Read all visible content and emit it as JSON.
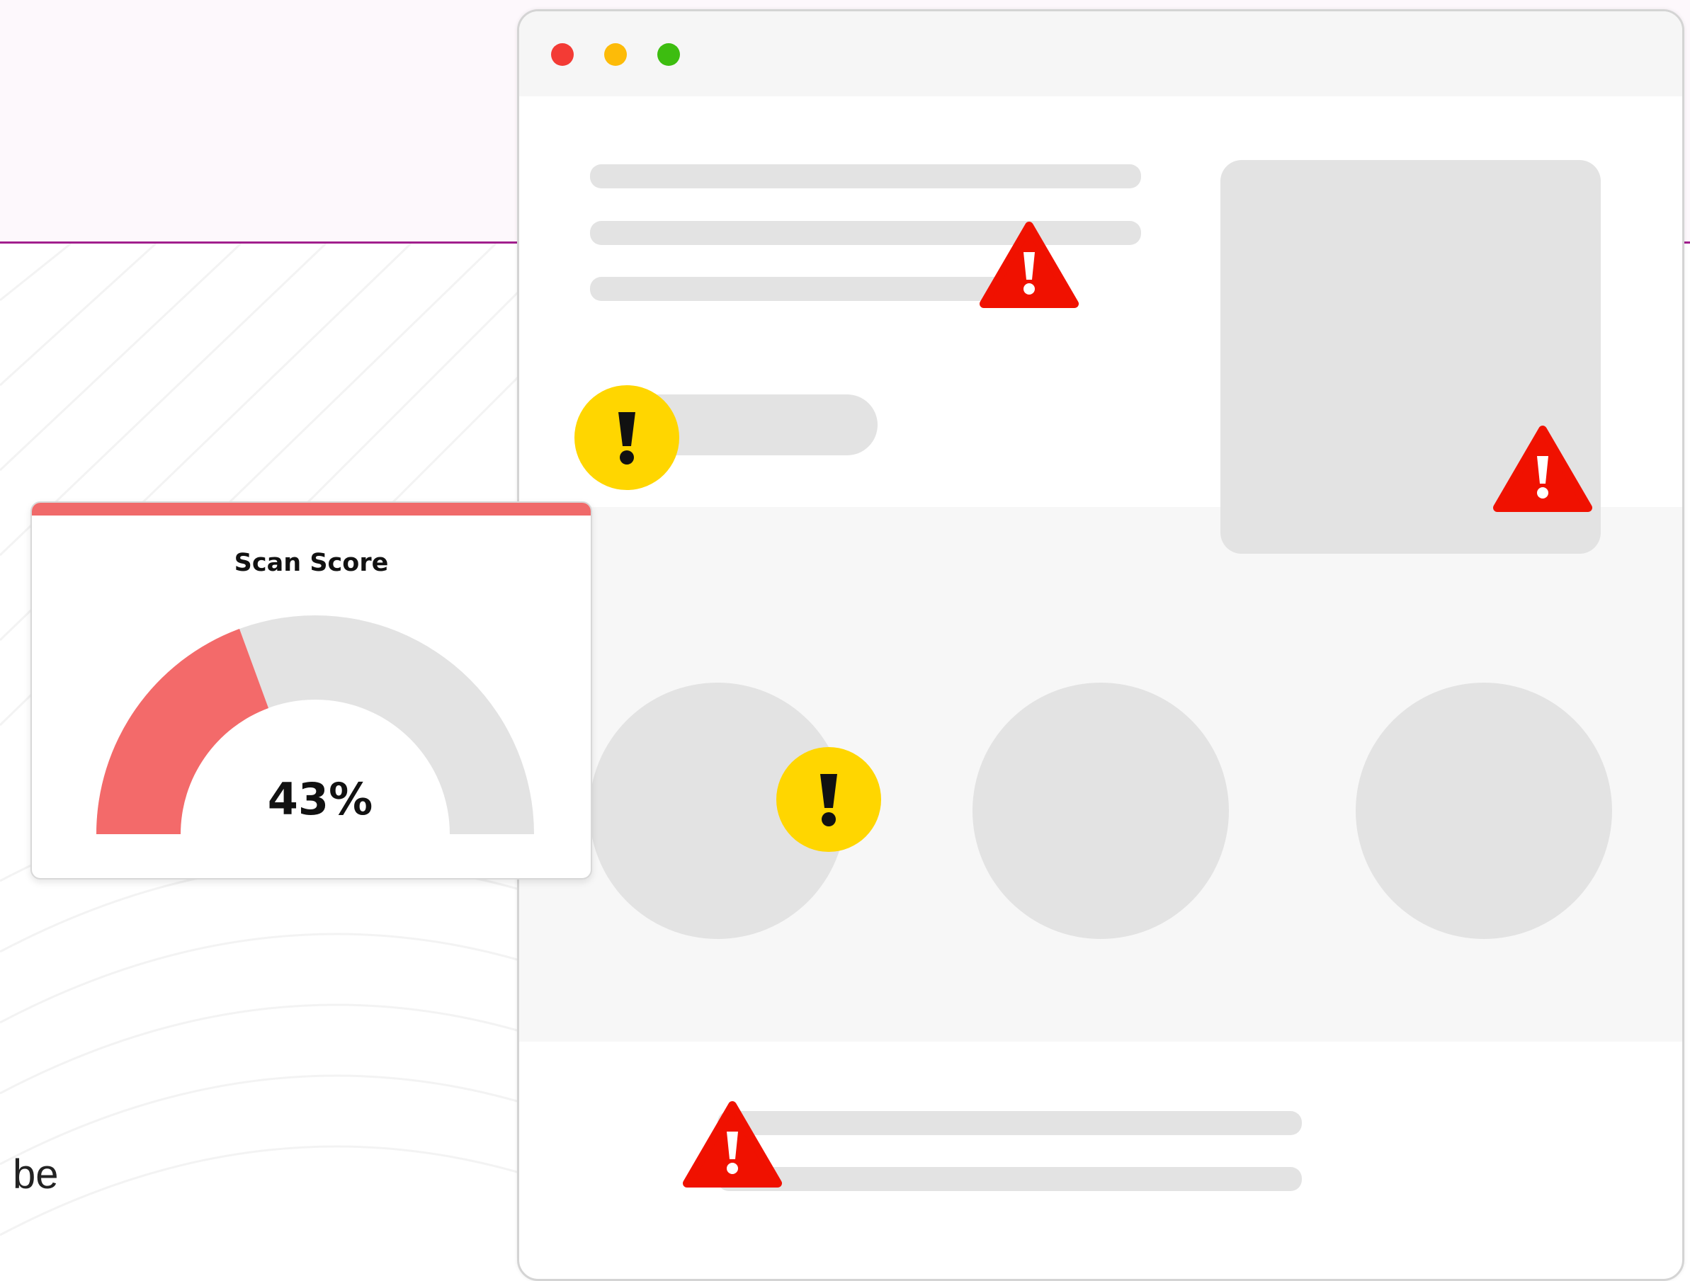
{
  "background": {
    "side_text": "be",
    "band_color": "#fdf8fc",
    "line_color": "#a11f8d"
  },
  "window": {
    "traffic_lights": [
      "#f33b35",
      "#fdbb08",
      "#3dbd10"
    ],
    "skeleton_color": "#e3e3e3",
    "warnings": {
      "critical_icon": "warning-triangle-icon",
      "critical_color": "#f01100",
      "moderate_icon": "exclamation-circle-icon",
      "moderate_color": "#ffd600"
    }
  },
  "score_card": {
    "title": "Scan Score",
    "value_label": "43%",
    "gauge_fill_color": "#f36a6a",
    "gauge_track_color": "#e3e3e3"
  }
}
